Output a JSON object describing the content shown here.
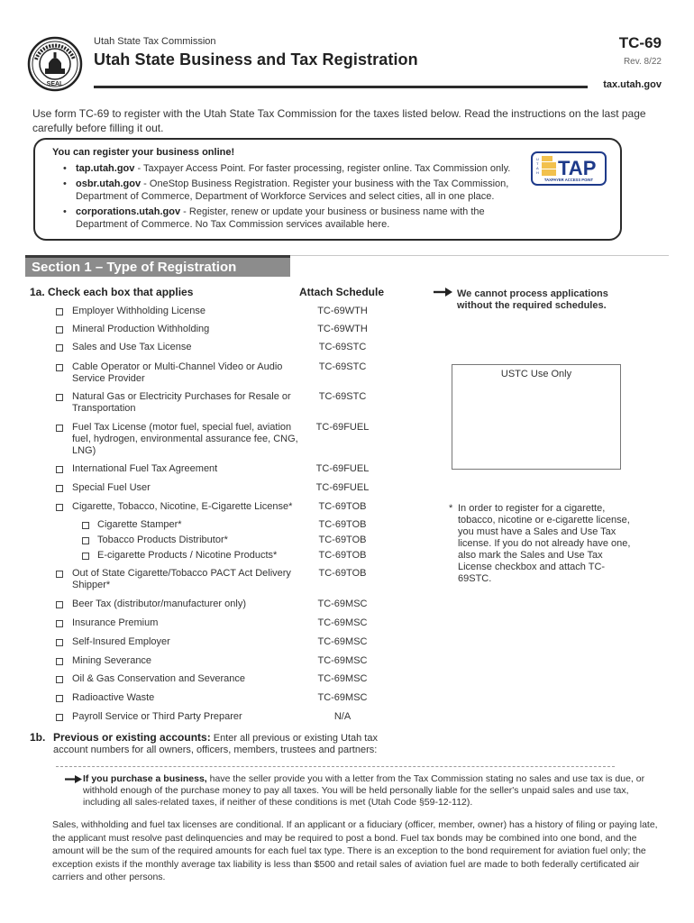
{
  "header": {
    "agency": "Utah State Tax Commission",
    "title": "Utah State Business and Tax Registration",
    "form_number": "TC-69",
    "revision": "Rev. 8/22",
    "website": "tax.utah.gov",
    "seal_icon": "state-seal-icon"
  },
  "intro": "Use form TC-69 to register with the Utah State Tax Commission for the taxes listed below. Read the instructions on the last page carefully before filling it out.",
  "online_box": {
    "heading": "You can register your business online!",
    "items": [
      {
        "site": "tap.utah.gov",
        "text": " - Taxpayer Access Point. For faster processing, register online. Tax Commission only."
      },
      {
        "site": "osbr.utah.gov",
        "text": " - OneStop Business Registration. Register your business with the Tax Commission, Department of Commerce, Department of Workforce Services and select cities, all in one place."
      },
      {
        "site": "corporations.utah.gov",
        "text": " - Register, renew or update your business or business name with the Department of Commerce. No Tax Commission services available here."
      }
    ],
    "logo": {
      "main": "TAP",
      "vertical": "UTAH",
      "sub": "TAXPAYER ACCESS POINT",
      "brand_color": "#1e3a8a",
      "accent_color": "#f2c14e"
    }
  },
  "section1": {
    "title": "Section 1 – Type of Registration",
    "q1a_label": "1a. Check each box that applies",
    "schedule_header": "Attach Schedule",
    "rows": [
      {
        "label": "Employer Withholding License",
        "schedule": "TC-69WTH",
        "checked": false
      },
      {
        "label": "Mineral Production Withholding",
        "schedule": "TC-69WTH",
        "checked": false
      },
      {
        "label": "Sales and Use Tax License",
        "schedule": "TC-69STC",
        "checked": false
      },
      {
        "label": "Cable Operator or Multi-Channel Video or Audio Service Provider",
        "schedule": "TC-69STC",
        "checked": false
      },
      {
        "label": "Natural Gas or Electricity Purchases for Resale or Transportation",
        "schedule": "TC-69STC",
        "checked": false
      },
      {
        "label": "Fuel Tax License (motor fuel, special fuel, aviation fuel, hydrogen, environmental assurance fee, CNG, LNG)",
        "schedule": "TC-69FUEL",
        "checked": false
      },
      {
        "label": "International Fuel Tax Agreement",
        "schedule": "TC-69FUEL",
        "checked": false
      },
      {
        "label": "Special Fuel User",
        "schedule": "TC-69FUEL",
        "checked": false
      },
      {
        "label": "Cigarette, Tobacco, Nicotine, E-Cigarette License*",
        "schedule": "TC-69TOB",
        "checked": false
      },
      {
        "label": "Cigarette Stamper*",
        "schedule": "TC-69TOB",
        "checked": false,
        "sub": true
      },
      {
        "label": "Tobacco Products Distributor*",
        "schedule": "TC-69TOB",
        "checked": false,
        "sub": true
      },
      {
        "label": "E-cigarette Products / Nicotine Products*",
        "schedule": "TC-69TOB",
        "checked": false,
        "sub": true
      },
      {
        "label": "Out of State Cigarette/Tobacco PACT Act Delivery Shipper*",
        "schedule": "TC-69TOB",
        "checked": false
      },
      {
        "label": "Beer Tax (distributor/manufacturer only)",
        "schedule": "TC-69MSC",
        "checked": false
      },
      {
        "label": "Insurance Premium",
        "schedule": "TC-69MSC",
        "checked": false
      },
      {
        "label": "Self-Insured Employer",
        "schedule": "TC-69MSC",
        "checked": false
      },
      {
        "label": "Mining Severance",
        "schedule": "TC-69MSC",
        "checked": false
      },
      {
        "label": "Oil & Gas Conservation and Severance",
        "schedule": "TC-69MSC",
        "checked": false
      },
      {
        "label": "Radioactive Waste",
        "schedule": "TC-69MSC",
        "checked": false
      },
      {
        "label": "Payroll Service or Third Party Preparer",
        "schedule": "N/A",
        "checked": false
      }
    ],
    "notice": "We cannot process applications without the required schedules.",
    "ustc_label": "USTC Use Only",
    "footnote_star": "*",
    "footnote": "In order to register for a cigarette, tobacco, nicotine or e-cigarette license, you must have a Sales and Use Tax license. If you do not already have one, also mark the Sales and Use Tax License checkbox and attach TC-69STC.",
    "q1b": {
      "number": "1b.",
      "bold": "Previous or existing accounts:",
      "text": " Enter all previous or existing Utah tax account numbers for all owners, officers, members, trustees and partners:",
      "value": ""
    },
    "purchase_notice": {
      "bold": "If you purchase a business,",
      "text": " have the seller provide you with a letter from the Tax Commission stating no sales and use tax is due, or withhold enough of the purchase money to pay all taxes. You will be held personally liable for the seller's unpaid sales and use tax, including all sales-related taxes, if neither of these conditions is met (Utah Code §59-12-112)."
    },
    "conditional": "Sales, withholding and fuel tax licenses are conditional. If an applicant or a fiduciary (officer, member, owner) has a history of filing or paying late, the applicant must resolve past delinquencies and may be required to post a bond. Fuel tax bonds may be combined into one bond, and the amount will be the sum of the required amounts for each fuel tax type. There is an exception to the bond requirement for aviation fuel only; the exception exists if the monthly average tax liability is less than $500 and retail sales of aviation fuel are made to both federally certificated air carriers and other persons."
  }
}
